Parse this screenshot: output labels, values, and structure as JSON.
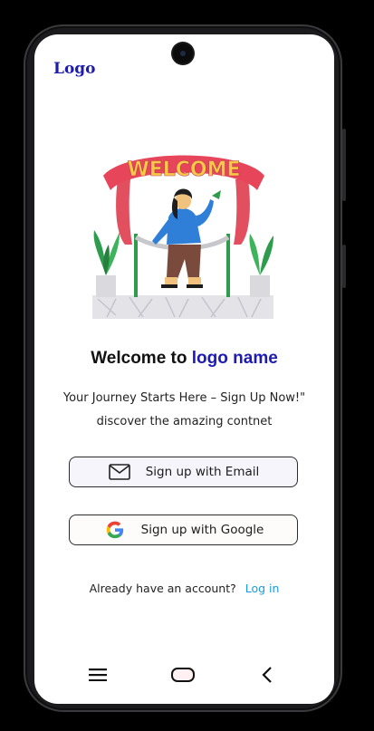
{
  "app": {
    "logo_text": "Logo"
  },
  "hero": {
    "banner_text": "WELCOME",
    "accent_color": "#1d1bb0"
  },
  "welcome": {
    "prefix": "Welcome  to",
    "brand": "logo name"
  },
  "subtitle": {
    "line1": "Your Journey Starts Here – Sign Up Now!\"",
    "line2": "discover the amazing contnet"
  },
  "buttons": {
    "email_label": "Sign up with Email",
    "google_label": "Sign up with Google"
  },
  "login": {
    "prompt": "Already have an account?",
    "link_label": "Log in",
    "link_color": "#1a9be0"
  },
  "navbar": {
    "icons": [
      "menu-icon",
      "home-icon",
      "back-icon"
    ]
  }
}
